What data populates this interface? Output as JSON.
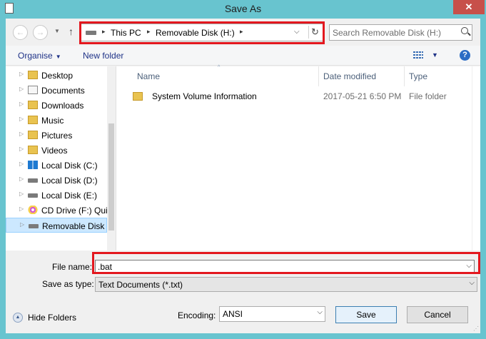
{
  "window": {
    "title": "Save As",
    "close_glyph": "✕"
  },
  "nav": {
    "back_glyph": "←",
    "forward_glyph": "→",
    "recent_glyph": "▼",
    "up_glyph": "↑"
  },
  "address": {
    "crumbs": [
      "This PC",
      "Removable Disk (H:)"
    ],
    "separator_glyph": "▸",
    "dropdown_glyph": "⌵",
    "refresh_glyph": "↻"
  },
  "search": {
    "placeholder": "Search Removable Disk (H:)"
  },
  "toolbar": {
    "organise_label": "Organise",
    "new_folder_label": "New folder",
    "caret_glyph": "▼",
    "help_glyph": "?"
  },
  "navpane": {
    "expander_glyph": "▷",
    "items": [
      {
        "label": "Desktop",
        "icon": "desktop-folder-icon"
      },
      {
        "label": "Documents",
        "icon": "documents-folder-icon"
      },
      {
        "label": "Downloads",
        "icon": "downloads-folder-icon"
      },
      {
        "label": "Music",
        "icon": "music-folder-icon"
      },
      {
        "label": "Pictures",
        "icon": "pictures-folder-icon"
      },
      {
        "label": "Videos",
        "icon": "videos-folder-icon"
      },
      {
        "label": "Local Disk (C:)",
        "icon": "windows-drive-icon"
      },
      {
        "label": "Local Disk (D:)",
        "icon": "drive-icon"
      },
      {
        "label": "Local Disk (E:)",
        "icon": "drive-icon"
      },
      {
        "label": "CD Drive (F:) Qui",
        "icon": "cd-drive-icon"
      },
      {
        "label": "Removable Disk (",
        "icon": "removable-drive-icon",
        "selected": true
      }
    ]
  },
  "filelist": {
    "columns": {
      "name": "Name",
      "date_modified": "Date modified",
      "type": "Type"
    },
    "sort_glyph": "^",
    "rows": [
      {
        "name": "System Volume Information",
        "date_modified": "2017-05-21 6:50 PM",
        "type": "File folder",
        "icon": "folder-icon"
      }
    ]
  },
  "form": {
    "file_name_label": "File name:",
    "file_name_value": ".bat",
    "save_as_type_label": "Save as type:",
    "save_as_type_value": "Text Documents (*.txt)",
    "encoding_label": "Encoding:",
    "encoding_value": "ANSI",
    "dropdown_glyph": "⌵"
  },
  "footer": {
    "hide_folders_label": "Hide Folders",
    "hide_folders_glyph": "▲",
    "save_label": "Save",
    "cancel_label": "Cancel",
    "grip_glyph": "⋰"
  },
  "colors": {
    "window_chrome": "#68c4cf",
    "highlight_box": "#e3171e",
    "close_button": "#c7504a",
    "selected_item": "#cce8ff",
    "link_text": "#1e3287"
  }
}
